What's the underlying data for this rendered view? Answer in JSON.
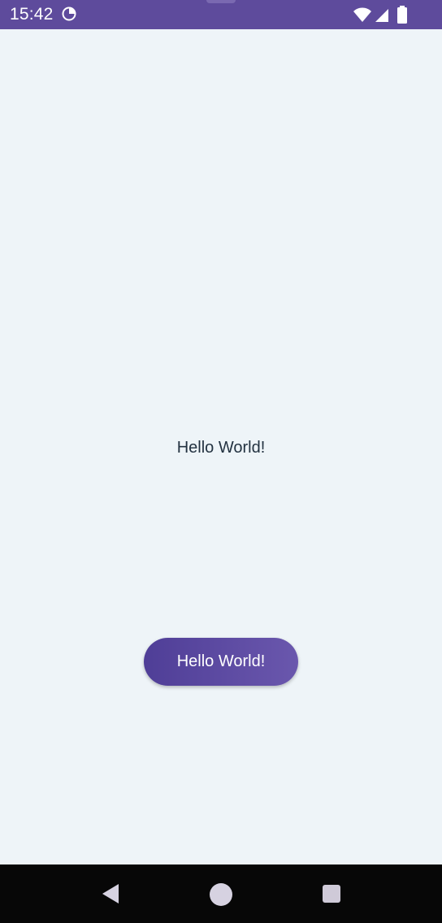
{
  "status_bar": {
    "time": "15:42",
    "app_icon": "sync-circle-icon",
    "wifi_icon": "wifi-icon",
    "signal_icon": "cell-signal-icon",
    "battery_icon": "battery-icon",
    "background_color": "#5e4b9c"
  },
  "main": {
    "hello_text": "Hello World!",
    "button_label": "Hello World!",
    "button_color": "#5a48a3",
    "background_color": "#eef4f8"
  },
  "nav_bar": {
    "back_icon": "back-triangle-icon",
    "home_icon": "home-circle-icon",
    "recents_icon": "recents-square-icon"
  }
}
